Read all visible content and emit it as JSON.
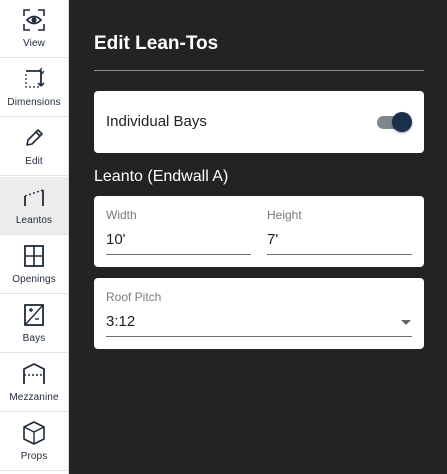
{
  "sidebar": {
    "items": [
      {
        "label": "View",
        "icon": "eye-icon"
      },
      {
        "label": "Dimensions",
        "icon": "dimensions-icon"
      },
      {
        "label": "Edit",
        "icon": "pencil-icon"
      },
      {
        "label": "Leantos",
        "icon": "leanto-icon",
        "active": true
      },
      {
        "label": "Openings",
        "icon": "window-icon"
      },
      {
        "label": "Bays",
        "icon": "bays-icon"
      },
      {
        "label": "Mezzanine",
        "icon": "mezzanine-icon"
      },
      {
        "label": "Props",
        "icon": "cube-icon"
      }
    ]
  },
  "panel": {
    "title": "Edit Lean-Tos",
    "individual_bays": {
      "label": "Individual Bays",
      "enabled": true
    },
    "section_title": "Leanto (Endwall A)",
    "width": {
      "label": "Width",
      "value": "10'"
    },
    "height": {
      "label": "Height",
      "value": "7'"
    },
    "roof_pitch": {
      "label": "Roof Pitch",
      "value": "3:12"
    }
  },
  "colors": {
    "panel_background": "#232323",
    "accent": "#1b2e4a",
    "sidebar_background": "#ffffff"
  }
}
